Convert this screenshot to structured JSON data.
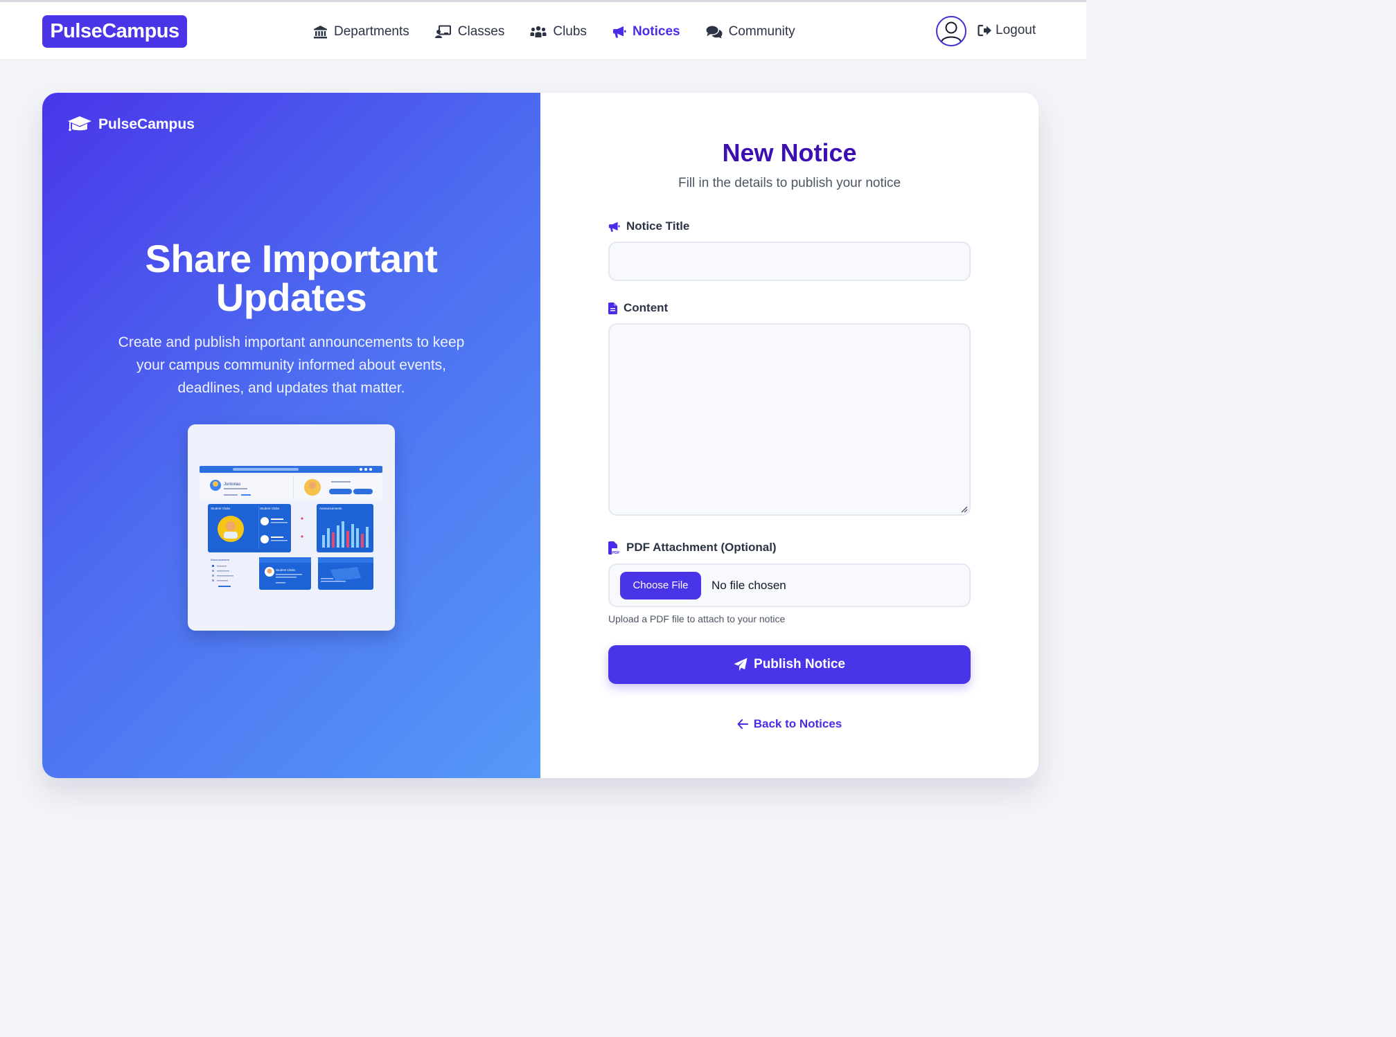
{
  "navbar": {
    "brand": "PulseCampus",
    "links": [
      {
        "label": "Departments",
        "icon": "building-columns-icon"
      },
      {
        "label": "Classes",
        "icon": "chalkboard-user-icon"
      },
      {
        "label": "Clubs",
        "icon": "people-group-icon"
      },
      {
        "label": "Notices",
        "icon": "bullhorn-icon",
        "active": true
      },
      {
        "label": "Community",
        "icon": "comments-icon"
      }
    ],
    "logout_label": "Logout",
    "accent_color": "#4a34e8"
  },
  "hero": {
    "brand": "PulseCampus",
    "title": "Share Important Updates",
    "description": "Create and publish important announcements to keep your campus community informed about events, deadlines, and updates that matter.",
    "preview_name": "Juntorias",
    "preview_panels": [
      "Student Clubs",
      "Student Clubs",
      "Announcements",
      "Announcement",
      "Student Clubs"
    ],
    "preview_card_name": "Student Clubs",
    "preview_chart_values": [
      0.45,
      0.7,
      0.55,
      0.8,
      0.95,
      0.6,
      0.85,
      0.7,
      0.5,
      0.75
    ]
  },
  "form": {
    "title": "New Notice",
    "subtitle": "Fill in the details to publish your notice",
    "title_label": "Notice Title",
    "title_value": "",
    "content_label": "Content",
    "content_value": "",
    "attachment_label": "PDF Attachment (Optional)",
    "choose_file_label": "Choose File",
    "file_status": "No file chosen",
    "attachment_hint": "Upload a PDF file to attach to your notice",
    "publish_label": "Publish Notice",
    "back_label": "Back to Notices"
  }
}
